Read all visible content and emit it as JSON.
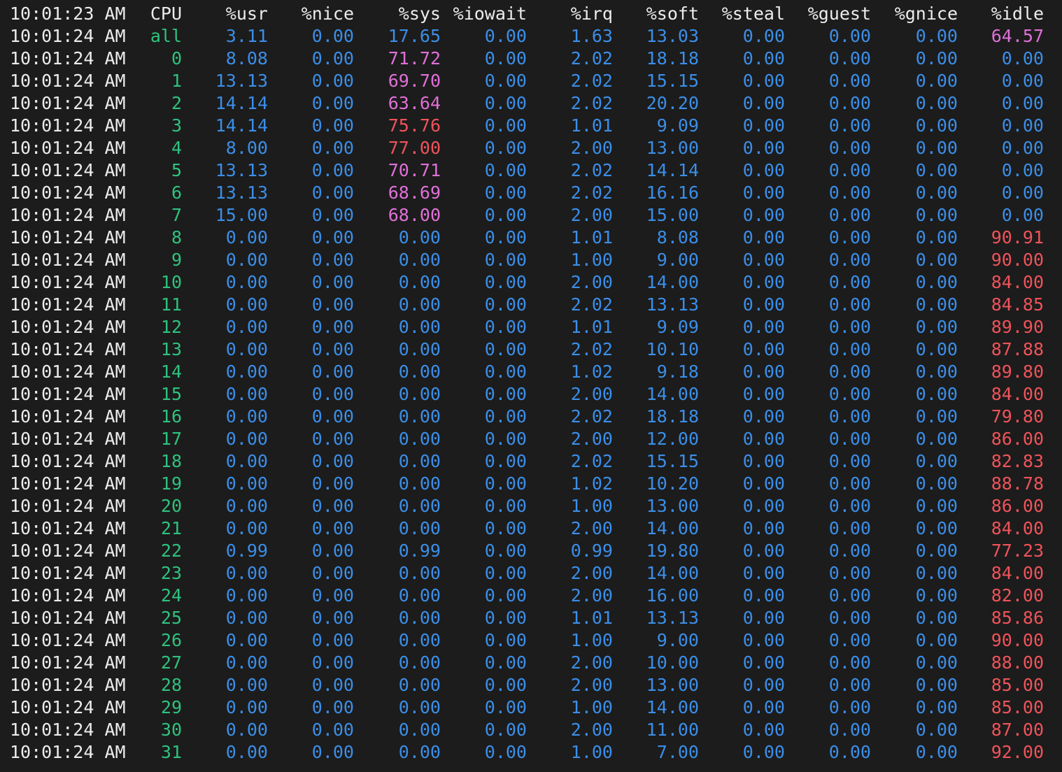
{
  "header": {
    "time": "10:01:23 AM",
    "labels": [
      "CPU",
      "%usr",
      "%nice",
      "%sys",
      "%iowait",
      "%irq",
      "%soft",
      "%steal",
      "%guest",
      "%gnice",
      "%idle"
    ]
  },
  "rows": [
    {
      "time": "10:01:24 AM",
      "cpu": "all",
      "usr": "3.11",
      "nice": "0.00",
      "sys": "17.65",
      "iowait": "0.00",
      "irq": "1.63",
      "soft": "13.03",
      "steal": "0.00",
      "guest": "0.00",
      "gnice": "0.00",
      "idle": "64.57"
    },
    {
      "time": "10:01:24 AM",
      "cpu": "0",
      "usr": "8.08",
      "nice": "0.00",
      "sys": "71.72",
      "iowait": "0.00",
      "irq": "2.02",
      "soft": "18.18",
      "steal": "0.00",
      "guest": "0.00",
      "gnice": "0.00",
      "idle": "0.00"
    },
    {
      "time": "10:01:24 AM",
      "cpu": "1",
      "usr": "13.13",
      "nice": "0.00",
      "sys": "69.70",
      "iowait": "0.00",
      "irq": "2.02",
      "soft": "15.15",
      "steal": "0.00",
      "guest": "0.00",
      "gnice": "0.00",
      "idle": "0.00"
    },
    {
      "time": "10:01:24 AM",
      "cpu": "2",
      "usr": "14.14",
      "nice": "0.00",
      "sys": "63.64",
      "iowait": "0.00",
      "irq": "2.02",
      "soft": "20.20",
      "steal": "0.00",
      "guest": "0.00",
      "gnice": "0.00",
      "idle": "0.00"
    },
    {
      "time": "10:01:24 AM",
      "cpu": "3",
      "usr": "14.14",
      "nice": "0.00",
      "sys": "75.76",
      "iowait": "0.00",
      "irq": "1.01",
      "soft": "9.09",
      "steal": "0.00",
      "guest": "0.00",
      "gnice": "0.00",
      "idle": "0.00"
    },
    {
      "time": "10:01:24 AM",
      "cpu": "4",
      "usr": "8.00",
      "nice": "0.00",
      "sys": "77.00",
      "iowait": "0.00",
      "irq": "2.00",
      "soft": "13.00",
      "steal": "0.00",
      "guest": "0.00",
      "gnice": "0.00",
      "idle": "0.00"
    },
    {
      "time": "10:01:24 AM",
      "cpu": "5",
      "usr": "13.13",
      "nice": "0.00",
      "sys": "70.71",
      "iowait": "0.00",
      "irq": "2.02",
      "soft": "14.14",
      "steal": "0.00",
      "guest": "0.00",
      "gnice": "0.00",
      "idle": "0.00"
    },
    {
      "time": "10:01:24 AM",
      "cpu": "6",
      "usr": "13.13",
      "nice": "0.00",
      "sys": "68.69",
      "iowait": "0.00",
      "irq": "2.02",
      "soft": "16.16",
      "steal": "0.00",
      "guest": "0.00",
      "gnice": "0.00",
      "idle": "0.00"
    },
    {
      "time": "10:01:24 AM",
      "cpu": "7",
      "usr": "15.00",
      "nice": "0.00",
      "sys": "68.00",
      "iowait": "0.00",
      "irq": "2.00",
      "soft": "15.00",
      "steal": "0.00",
      "guest": "0.00",
      "gnice": "0.00",
      "idle": "0.00"
    },
    {
      "time": "10:01:24 AM",
      "cpu": "8",
      "usr": "0.00",
      "nice": "0.00",
      "sys": "0.00",
      "iowait": "0.00",
      "irq": "1.01",
      "soft": "8.08",
      "steal": "0.00",
      "guest": "0.00",
      "gnice": "0.00",
      "idle": "90.91"
    },
    {
      "time": "10:01:24 AM",
      "cpu": "9",
      "usr": "0.00",
      "nice": "0.00",
      "sys": "0.00",
      "iowait": "0.00",
      "irq": "1.00",
      "soft": "9.00",
      "steal": "0.00",
      "guest": "0.00",
      "gnice": "0.00",
      "idle": "90.00"
    },
    {
      "time": "10:01:24 AM",
      "cpu": "10",
      "usr": "0.00",
      "nice": "0.00",
      "sys": "0.00",
      "iowait": "0.00",
      "irq": "2.00",
      "soft": "14.00",
      "steal": "0.00",
      "guest": "0.00",
      "gnice": "0.00",
      "idle": "84.00"
    },
    {
      "time": "10:01:24 AM",
      "cpu": "11",
      "usr": "0.00",
      "nice": "0.00",
      "sys": "0.00",
      "iowait": "0.00",
      "irq": "2.02",
      "soft": "13.13",
      "steal": "0.00",
      "guest": "0.00",
      "gnice": "0.00",
      "idle": "84.85"
    },
    {
      "time": "10:01:24 AM",
      "cpu": "12",
      "usr": "0.00",
      "nice": "0.00",
      "sys": "0.00",
      "iowait": "0.00",
      "irq": "1.01",
      "soft": "9.09",
      "steal": "0.00",
      "guest": "0.00",
      "gnice": "0.00",
      "idle": "89.90"
    },
    {
      "time": "10:01:24 AM",
      "cpu": "13",
      "usr": "0.00",
      "nice": "0.00",
      "sys": "0.00",
      "iowait": "0.00",
      "irq": "2.02",
      "soft": "10.10",
      "steal": "0.00",
      "guest": "0.00",
      "gnice": "0.00",
      "idle": "87.88"
    },
    {
      "time": "10:01:24 AM",
      "cpu": "14",
      "usr": "0.00",
      "nice": "0.00",
      "sys": "0.00",
      "iowait": "0.00",
      "irq": "1.02",
      "soft": "9.18",
      "steal": "0.00",
      "guest": "0.00",
      "gnice": "0.00",
      "idle": "89.80"
    },
    {
      "time": "10:01:24 AM",
      "cpu": "15",
      "usr": "0.00",
      "nice": "0.00",
      "sys": "0.00",
      "iowait": "0.00",
      "irq": "2.00",
      "soft": "14.00",
      "steal": "0.00",
      "guest": "0.00",
      "gnice": "0.00",
      "idle": "84.00"
    },
    {
      "time": "10:01:24 AM",
      "cpu": "16",
      "usr": "0.00",
      "nice": "0.00",
      "sys": "0.00",
      "iowait": "0.00",
      "irq": "2.02",
      "soft": "18.18",
      "steal": "0.00",
      "guest": "0.00",
      "gnice": "0.00",
      "idle": "79.80"
    },
    {
      "time": "10:01:24 AM",
      "cpu": "17",
      "usr": "0.00",
      "nice": "0.00",
      "sys": "0.00",
      "iowait": "0.00",
      "irq": "2.00",
      "soft": "12.00",
      "steal": "0.00",
      "guest": "0.00",
      "gnice": "0.00",
      "idle": "86.00"
    },
    {
      "time": "10:01:24 AM",
      "cpu": "18",
      "usr": "0.00",
      "nice": "0.00",
      "sys": "0.00",
      "iowait": "0.00",
      "irq": "2.02",
      "soft": "15.15",
      "steal": "0.00",
      "guest": "0.00",
      "gnice": "0.00",
      "idle": "82.83"
    },
    {
      "time": "10:01:24 AM",
      "cpu": "19",
      "usr": "0.00",
      "nice": "0.00",
      "sys": "0.00",
      "iowait": "0.00",
      "irq": "1.02",
      "soft": "10.20",
      "steal": "0.00",
      "guest": "0.00",
      "gnice": "0.00",
      "idle": "88.78"
    },
    {
      "time": "10:01:24 AM",
      "cpu": "20",
      "usr": "0.00",
      "nice": "0.00",
      "sys": "0.00",
      "iowait": "0.00",
      "irq": "1.00",
      "soft": "13.00",
      "steal": "0.00",
      "guest": "0.00",
      "gnice": "0.00",
      "idle": "86.00"
    },
    {
      "time": "10:01:24 AM",
      "cpu": "21",
      "usr": "0.00",
      "nice": "0.00",
      "sys": "0.00",
      "iowait": "0.00",
      "irq": "2.00",
      "soft": "14.00",
      "steal": "0.00",
      "guest": "0.00",
      "gnice": "0.00",
      "idle": "84.00"
    },
    {
      "time": "10:01:24 AM",
      "cpu": "22",
      "usr": "0.99",
      "nice": "0.00",
      "sys": "0.99",
      "iowait": "0.00",
      "irq": "0.99",
      "soft": "19.80",
      "steal": "0.00",
      "guest": "0.00",
      "gnice": "0.00",
      "idle": "77.23"
    },
    {
      "time": "10:01:24 AM",
      "cpu": "23",
      "usr": "0.00",
      "nice": "0.00",
      "sys": "0.00",
      "iowait": "0.00",
      "irq": "2.00",
      "soft": "14.00",
      "steal": "0.00",
      "guest": "0.00",
      "gnice": "0.00",
      "idle": "84.00"
    },
    {
      "time": "10:01:24 AM",
      "cpu": "24",
      "usr": "0.00",
      "nice": "0.00",
      "sys": "0.00",
      "iowait": "0.00",
      "irq": "2.00",
      "soft": "16.00",
      "steal": "0.00",
      "guest": "0.00",
      "gnice": "0.00",
      "idle": "82.00"
    },
    {
      "time": "10:01:24 AM",
      "cpu": "25",
      "usr": "0.00",
      "nice": "0.00",
      "sys": "0.00",
      "iowait": "0.00",
      "irq": "1.01",
      "soft": "13.13",
      "steal": "0.00",
      "guest": "0.00",
      "gnice": "0.00",
      "idle": "85.86"
    },
    {
      "time": "10:01:24 AM",
      "cpu": "26",
      "usr": "0.00",
      "nice": "0.00",
      "sys": "0.00",
      "iowait": "0.00",
      "irq": "1.00",
      "soft": "9.00",
      "steal": "0.00",
      "guest": "0.00",
      "gnice": "0.00",
      "idle": "90.00"
    },
    {
      "time": "10:01:24 AM",
      "cpu": "27",
      "usr": "0.00",
      "nice": "0.00",
      "sys": "0.00",
      "iowait": "0.00",
      "irq": "2.00",
      "soft": "10.00",
      "steal": "0.00",
      "guest": "0.00",
      "gnice": "0.00",
      "idle": "88.00"
    },
    {
      "time": "10:01:24 AM",
      "cpu": "28",
      "usr": "0.00",
      "nice": "0.00",
      "sys": "0.00",
      "iowait": "0.00",
      "irq": "2.00",
      "soft": "13.00",
      "steal": "0.00",
      "guest": "0.00",
      "gnice": "0.00",
      "idle": "85.00"
    },
    {
      "time": "10:01:24 AM",
      "cpu": "29",
      "usr": "0.00",
      "nice": "0.00",
      "sys": "0.00",
      "iowait": "0.00",
      "irq": "1.00",
      "soft": "14.00",
      "steal": "0.00",
      "guest": "0.00",
      "gnice": "0.00",
      "idle": "85.00"
    },
    {
      "time": "10:01:24 AM",
      "cpu": "30",
      "usr": "0.00",
      "nice": "0.00",
      "sys": "0.00",
      "iowait": "0.00",
      "irq": "2.00",
      "soft": "11.00",
      "steal": "0.00",
      "guest": "0.00",
      "gnice": "0.00",
      "idle": "87.00"
    },
    {
      "time": "10:01:24 AM",
      "cpu": "31",
      "usr": "0.00",
      "nice": "0.00",
      "sys": "0.00",
      "iowait": "0.00",
      "irq": "1.00",
      "soft": "7.00",
      "steal": "0.00",
      "guest": "0.00",
      "gnice": "0.00",
      "idle": "92.00"
    }
  ],
  "colors": {
    "background": "#1c1c1c",
    "text": "#ececec",
    "cpu_id": "#2ec27e",
    "value_low": "#3b8ee8",
    "value_mid": "#e070d8",
    "value_high": "#f0535a"
  }
}
